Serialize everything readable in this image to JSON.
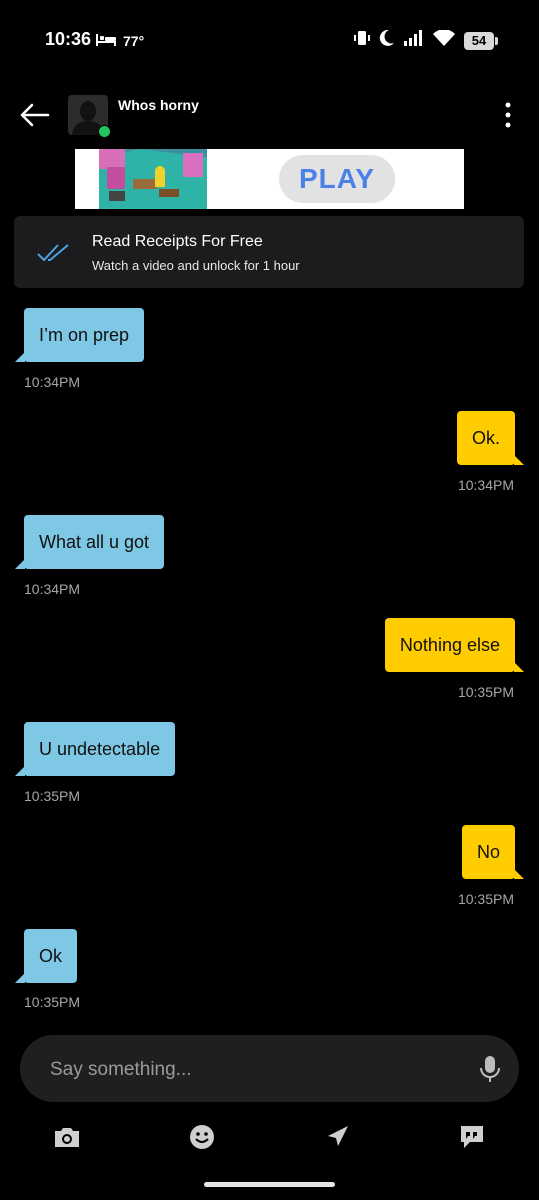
{
  "status_bar": {
    "time": "10:36",
    "temperature": "77°",
    "battery": "54"
  },
  "header": {
    "name": "Whos horny"
  },
  "ad": {
    "play_label": "PLAY"
  },
  "read_receipts": {
    "title": "Read Receipts For Free",
    "subtitle": "Watch a video and unlock for 1 hour"
  },
  "messages": [
    {
      "direction": "in",
      "text": "I’m on prep",
      "time": "10:34PM"
    },
    {
      "direction": "out",
      "text": "Ok.",
      "time": "10:34PM"
    },
    {
      "direction": "in",
      "text": "What all u got",
      "time": "10:34PM"
    },
    {
      "direction": "out",
      "text": "Nothing else",
      "time": "10:35PM"
    },
    {
      "direction": "in",
      "text": "U undetectable",
      "time": "10:35PM"
    },
    {
      "direction": "out",
      "text": "No",
      "time": "10:35PM"
    },
    {
      "direction": "in",
      "text": "Ok",
      "time": "10:35PM"
    }
  ],
  "composer": {
    "placeholder": "Say something..."
  },
  "toolbar": [
    "camera-icon",
    "emoji-icon",
    "location-icon",
    "saved-phrases-icon"
  ],
  "colors": {
    "incoming_bubble": "#7ec8e6",
    "outgoing_bubble": "#ffcc00",
    "online": "#22c55e",
    "receipt_check": "#4aa3df"
  }
}
